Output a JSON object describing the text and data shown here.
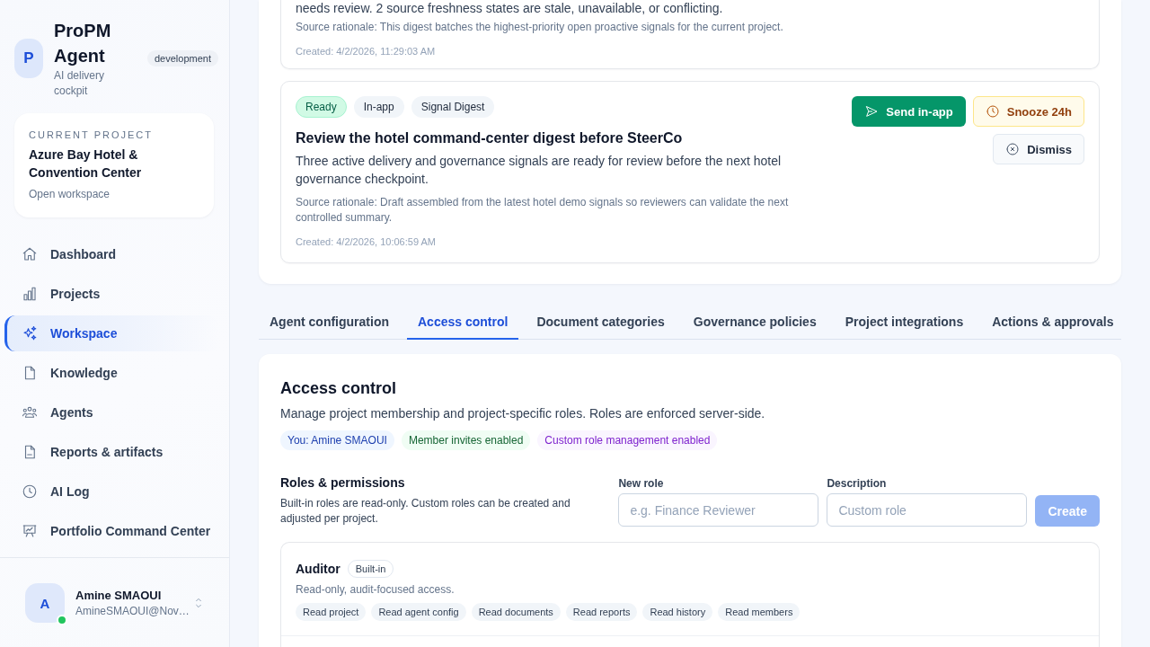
{
  "sidebar": {
    "brand": {
      "logo_letter": "P",
      "name": "ProPM Agent",
      "tagline": "AI delivery cockpit",
      "environment": "development"
    },
    "current_project": {
      "label": "CURRENT PROJECT",
      "name": "Azure Bay Hotel & Convention Center",
      "link": "Open workspace"
    },
    "nav": [
      {
        "label": "Dashboard",
        "selected": false
      },
      {
        "label": "Projects",
        "selected": false
      },
      {
        "label": "Workspace",
        "selected": true
      },
      {
        "label": "Knowledge",
        "selected": false
      },
      {
        "label": "Agents",
        "selected": false
      },
      {
        "label": "Reports & artifacts",
        "selected": false
      },
      {
        "label": "AI Log",
        "selected": false
      },
      {
        "label": "Portfolio Command Center",
        "selected": false
      }
    ],
    "user": {
      "initial": "A",
      "name": "Amine SMAOUI",
      "email": "AmineSMAOUI@Nov…",
      "online": true
    }
  },
  "digests": [
    {
      "description": "needs review. 2 source freshness states are stale, unavailable, or conflicting.",
      "rationale": "Source rationale: This digest batches the highest-priority open proactive signals for the current project.",
      "created": "Created: 4/2/2026, 11:29:03 AM"
    },
    {
      "badges": [
        {
          "label": "Ready",
          "kind": "status"
        },
        {
          "label": "In-app",
          "kind": "tag"
        },
        {
          "label": "Signal Digest",
          "kind": "tag"
        }
      ],
      "title": "Review the hotel command-center digest before SteerCo",
      "description": "Three active delivery and governance signals are ready for review before the next hotel governance checkpoint.",
      "rationale": "Source rationale: Draft assembled from the latest hotel demo signals so reviewers can validate the next controlled summary.",
      "created": "Created: 4/2/2026, 10:06:59 AM",
      "actions": [
        {
          "label": "Send in-app",
          "kind": "primary"
        },
        {
          "label": "Snooze 24h",
          "kind": "snooze"
        },
        {
          "label": "Dismiss",
          "kind": "dismiss"
        }
      ]
    }
  ],
  "tabs": [
    {
      "label": "Agent configuration",
      "selected": false
    },
    {
      "label": "Access control",
      "selected": true
    },
    {
      "label": "Document categories",
      "selected": false
    },
    {
      "label": "Governance policies",
      "selected": false
    },
    {
      "label": "Project integrations",
      "selected": false
    },
    {
      "label": "Actions & approvals",
      "selected": false
    }
  ],
  "access_control": {
    "title": "Access control",
    "description": "Manage project membership and project-specific roles. Roles are enforced server-side.",
    "chips": [
      {
        "label": "You: Amine SMAOUI",
        "kind": "user"
      },
      {
        "label": "Member invites enabled",
        "kind": "invites"
      },
      {
        "label": "Custom role management enabled",
        "kind": "roles"
      }
    ],
    "roles_section": {
      "title": "Roles & permissions",
      "description": "Built-in roles are read-only. Custom roles can be created and adjusted per project.",
      "fields": [
        {
          "label": "New role",
          "placeholder": "e.g. Finance Reviewer"
        },
        {
          "label": "Description",
          "placeholder": "Custom role"
        }
      ],
      "create_button": {
        "label": "Create",
        "disabled": true
      },
      "roles": [
        {
          "name": "Auditor",
          "badge": "Built-in",
          "description": "Read-only, audit-focused access.",
          "permissions": [
            "Read project",
            "Read agent config",
            "Read documents",
            "Read reports",
            "Read history",
            "Read members"
          ]
        }
      ]
    }
  }
}
